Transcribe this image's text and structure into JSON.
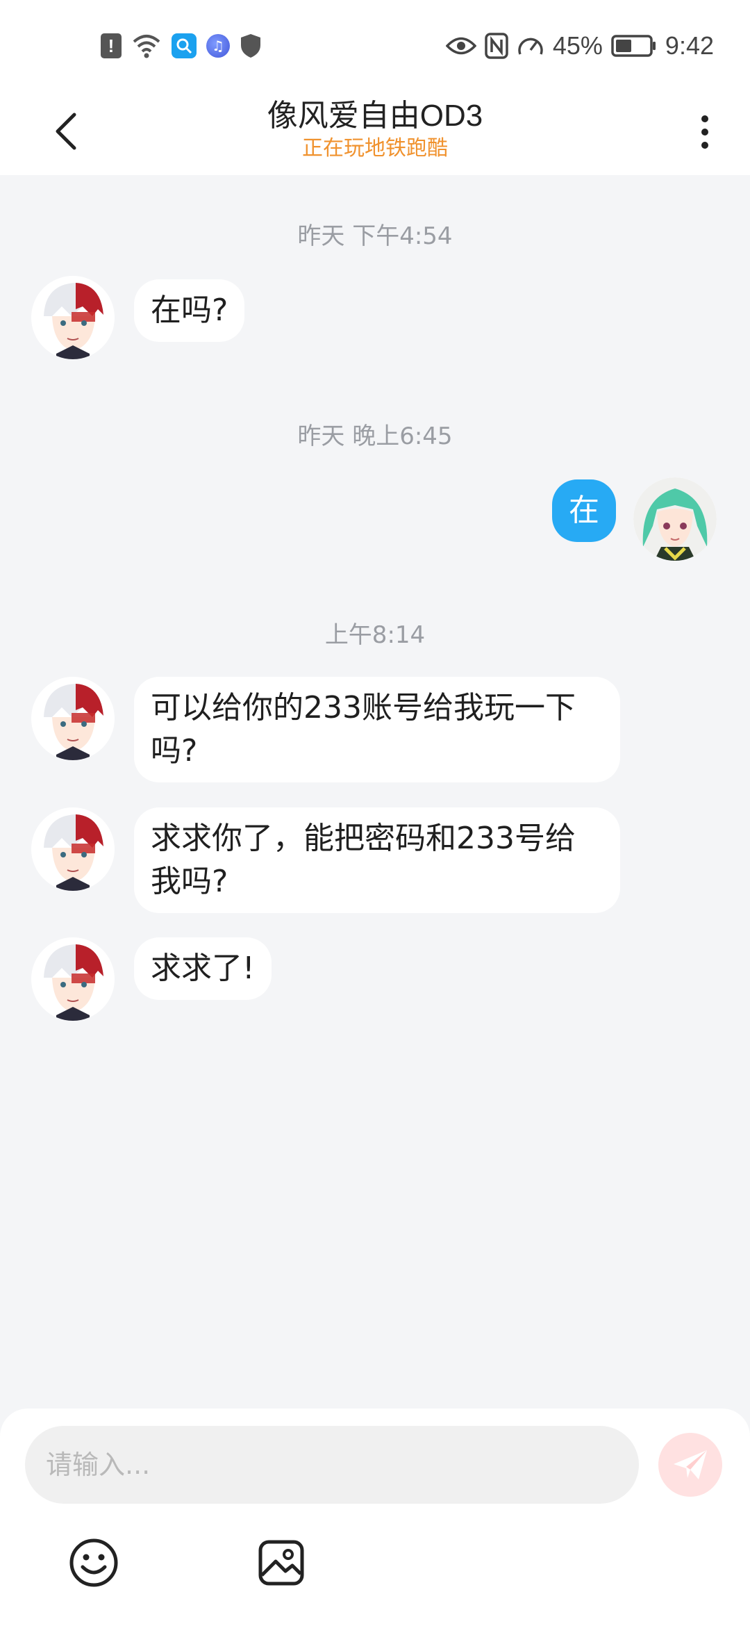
{
  "status_bar": {
    "battery_percent": "45%",
    "time": "9:42"
  },
  "header": {
    "title": "像风爱自由OD3",
    "subtitle": "正在玩地铁跑酷"
  },
  "chat": {
    "timestamps": [
      "昨天 下午4:54",
      "昨天 晚上6:45",
      "上午8:14"
    ],
    "messages": [
      {
        "text": "在吗?",
        "from": "other"
      },
      {
        "text": "在",
        "from": "self"
      },
      {
        "text": "可以给你的233账号给我玩一下吗?",
        "from": "other"
      },
      {
        "text": "求求你了，能把密码和233号给我吗?",
        "from": "other"
      },
      {
        "text": "求求了!",
        "from": "other"
      }
    ]
  },
  "composer": {
    "placeholder": "请输入..."
  },
  "colors": {
    "accent": "#27aaf4",
    "subtitle": "#f0922e",
    "background": "#f4f5f7"
  },
  "icons": [
    "back-icon",
    "more-icon",
    "send-icon",
    "emoji-icon",
    "image-icon"
  ]
}
